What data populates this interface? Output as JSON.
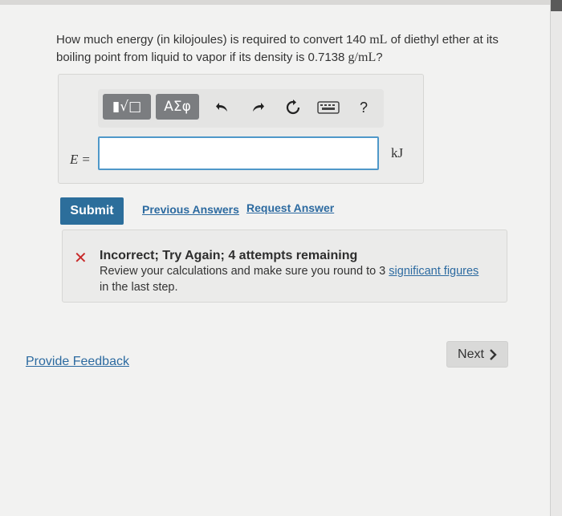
{
  "question": {
    "text_a": "How much energy (in kilojoules) is required to convert 140",
    "unit_ml": "mL",
    "text_b": "of diethyl ether at its",
    "text_c": "boiling point from liquid to vapor if its density is 0.7138",
    "unit_density": "g/mL",
    "text_end": "?"
  },
  "toolbar": {
    "template_label": "▮√□",
    "symbols_label": "ΑΣφ",
    "undo_icon": "undo-icon",
    "redo_icon": "redo-icon",
    "reset_icon": "reset-icon",
    "keyboard_icon": "keyboard-icon",
    "help_label": "?"
  },
  "answer": {
    "variable": "E",
    "equals": "=",
    "value": "",
    "unit": "kJ"
  },
  "actions": {
    "submit_label": "Submit",
    "previous_answers_label": "Previous Answers",
    "request_answer_label": "Request Answer"
  },
  "feedback": {
    "title": "Incorrect; Try Again; 4 attempts remaining",
    "line1_prefix": "Review your calculations and make sure you round to 3",
    "link_text": "significant figures",
    "line2": "in the last step."
  },
  "footer": {
    "provide_feedback_label": "Provide Feedback",
    "next_label": "Next"
  },
  "colors": {
    "accent": "#2c6e9b",
    "link": "#2c6aa0",
    "error": "#c82a2a",
    "input_border": "#4f98c9"
  }
}
